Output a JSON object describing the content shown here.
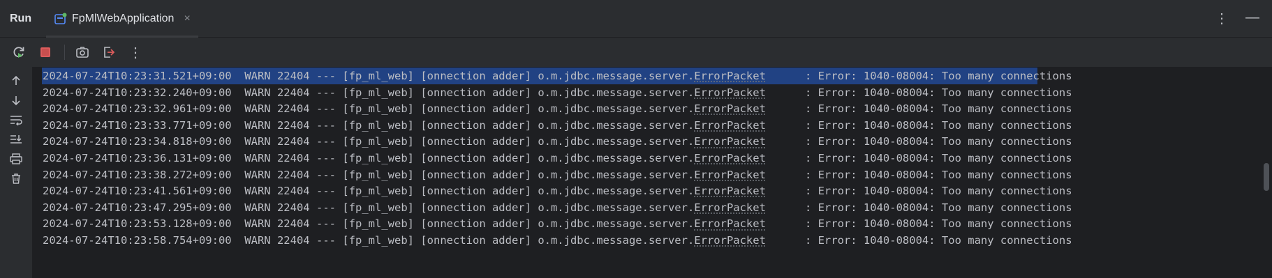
{
  "header": {
    "run_label": "Run",
    "tab_title": "FpMlWebApplication",
    "tab_close": "×",
    "more_glyph": "⋮",
    "minimize_glyph": "—"
  },
  "toolbar": {
    "more_glyph": "⋮"
  },
  "log": {
    "lines": [
      {
        "ts": "2024-07-24T10:23:31.521+09:00",
        "level": "WARN",
        "pid": "22404",
        "sep": "---",
        "app": "[fp_ml_web]",
        "thread": "[onnection adder]",
        "pkg": "o.m.jdbc.message.server.",
        "cls": "ErrorPacket",
        "msg": ": Error: 1040-08004: Too many connections"
      },
      {
        "ts": "2024-07-24T10:23:32.240+09:00",
        "level": "WARN",
        "pid": "22404",
        "sep": "---",
        "app": "[fp_ml_web]",
        "thread": "[onnection adder]",
        "pkg": "o.m.jdbc.message.server.",
        "cls": "ErrorPacket",
        "msg": ": Error: 1040-08004: Too many connections"
      },
      {
        "ts": "2024-07-24T10:23:32.961+09:00",
        "level": "WARN",
        "pid": "22404",
        "sep": "---",
        "app": "[fp_ml_web]",
        "thread": "[onnection adder]",
        "pkg": "o.m.jdbc.message.server.",
        "cls": "ErrorPacket",
        "msg": ": Error: 1040-08004: Too many connections"
      },
      {
        "ts": "2024-07-24T10:23:33.771+09:00",
        "level": "WARN",
        "pid": "22404",
        "sep": "---",
        "app": "[fp_ml_web]",
        "thread": "[onnection adder]",
        "pkg": "o.m.jdbc.message.server.",
        "cls": "ErrorPacket",
        "msg": ": Error: 1040-08004: Too many connections"
      },
      {
        "ts": "2024-07-24T10:23:34.818+09:00",
        "level": "WARN",
        "pid": "22404",
        "sep": "---",
        "app": "[fp_ml_web]",
        "thread": "[onnection adder]",
        "pkg": "o.m.jdbc.message.server.",
        "cls": "ErrorPacket",
        "msg": ": Error: 1040-08004: Too many connections"
      },
      {
        "ts": "2024-07-24T10:23:36.131+09:00",
        "level": "WARN",
        "pid": "22404",
        "sep": "---",
        "app": "[fp_ml_web]",
        "thread": "[onnection adder]",
        "pkg": "o.m.jdbc.message.server.",
        "cls": "ErrorPacket",
        "msg": ": Error: 1040-08004: Too many connections"
      },
      {
        "ts": "2024-07-24T10:23:38.272+09:00",
        "level": "WARN",
        "pid": "22404",
        "sep": "---",
        "app": "[fp_ml_web]",
        "thread": "[onnection adder]",
        "pkg": "o.m.jdbc.message.server.",
        "cls": "ErrorPacket",
        "msg": ": Error: 1040-08004: Too many connections"
      },
      {
        "ts": "2024-07-24T10:23:41.561+09:00",
        "level": "WARN",
        "pid": "22404",
        "sep": "---",
        "app": "[fp_ml_web]",
        "thread": "[onnection adder]",
        "pkg": "o.m.jdbc.message.server.",
        "cls": "ErrorPacket",
        "msg": ": Error: 1040-08004: Too many connections"
      },
      {
        "ts": "2024-07-24T10:23:47.295+09:00",
        "level": "WARN",
        "pid": "22404",
        "sep": "---",
        "app": "[fp_ml_web]",
        "thread": "[onnection adder]",
        "pkg": "o.m.jdbc.message.server.",
        "cls": "ErrorPacket",
        "msg": ": Error: 1040-08004: Too many connections"
      },
      {
        "ts": "2024-07-24T10:23:53.128+09:00",
        "level": "WARN",
        "pid": "22404",
        "sep": "---",
        "app": "[fp_ml_web]",
        "thread": "[onnection adder]",
        "pkg": "o.m.jdbc.message.server.",
        "cls": "ErrorPacket",
        "msg": ": Error: 1040-08004: Too many connections"
      },
      {
        "ts": "2024-07-24T10:23:58.754+09:00",
        "level": "WARN",
        "pid": "22404",
        "sep": "---",
        "app": "[fp_ml_web]",
        "thread": "[onnection adder]",
        "pkg": "o.m.jdbc.message.server.",
        "cls": "ErrorPacket",
        "msg": ": Error: 1040-08004: Too many connections"
      }
    ]
  },
  "colors": {
    "background": "#1e1f22",
    "panel": "#2b2d30",
    "selection": "#214283",
    "stop_red": "#db5c5c",
    "rerun_green": "#5fb865",
    "text": "#bcbec4"
  }
}
